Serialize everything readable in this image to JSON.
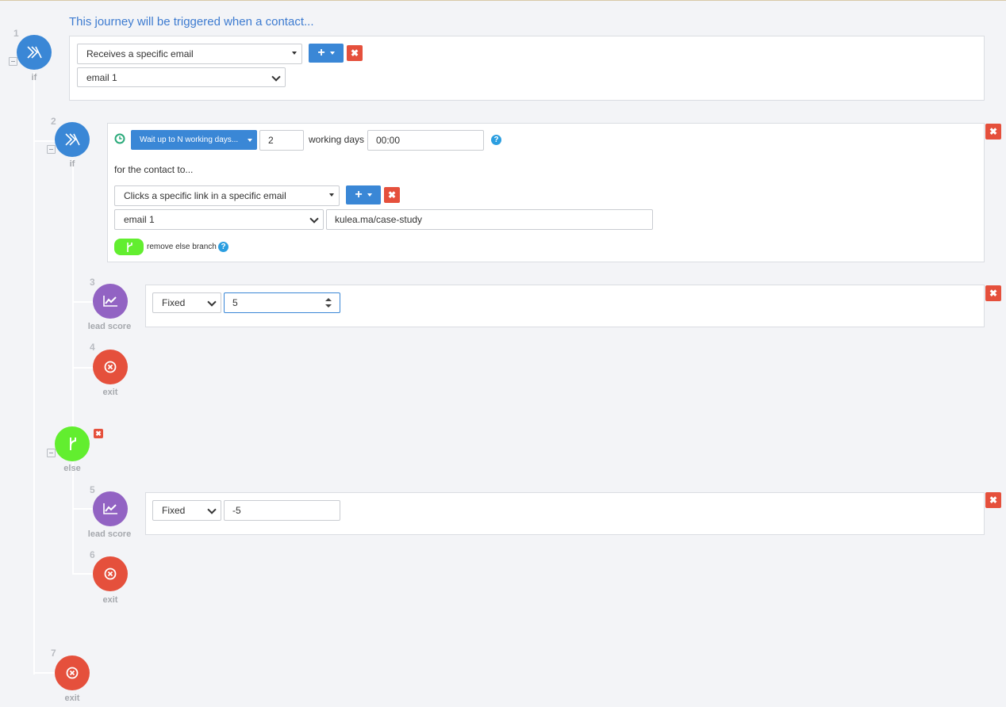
{
  "header": {
    "title": "This journey will be triggered when a contact..."
  },
  "steps": [
    {
      "num": "1",
      "label": "if",
      "icon": "journey-arrows-icon",
      "color": "#3a87d6"
    },
    {
      "num": "2",
      "label": "if",
      "icon": "journey-arrows-icon",
      "color": "#3a87d6"
    },
    {
      "num": "3",
      "label": "lead score",
      "icon": "chart-trend-icon",
      "color": "#9263c3"
    },
    {
      "num": "4",
      "label": "exit",
      "icon": "exit-circle-icon",
      "color": "#e5503c"
    },
    {
      "num": "",
      "label": "else",
      "icon": "branch-icon",
      "color": "#62ee2f"
    },
    {
      "num": "5",
      "label": "lead score",
      "icon": "chart-trend-icon",
      "color": "#9263c3"
    },
    {
      "num": "6",
      "label": "exit",
      "icon": "exit-circle-icon",
      "color": "#e5503c"
    },
    {
      "num": "7",
      "label": "exit",
      "icon": "exit-circle-icon",
      "color": "#e5503c"
    }
  ],
  "trigger": {
    "condition": "Receives a specific email",
    "email": "email 1"
  },
  "wait": {
    "mode": "Wait up to N working days...",
    "days": "2",
    "days_label": "working days",
    "time": "00:00",
    "for_contact_label": "for the contact to...",
    "condition": "Clicks a specific link in a specific email",
    "email": "email 1",
    "link": "kulea.ma/case-study",
    "else_toggle_label": "remove else branch"
  },
  "lead_score_1": {
    "type": "Fixed",
    "value": "5"
  },
  "lead_score_2": {
    "type": "Fixed",
    "value": "-5"
  },
  "icons": {
    "close": "close-icon",
    "help": "help-icon",
    "clock": "clock-icon",
    "plus": "plus-icon"
  }
}
